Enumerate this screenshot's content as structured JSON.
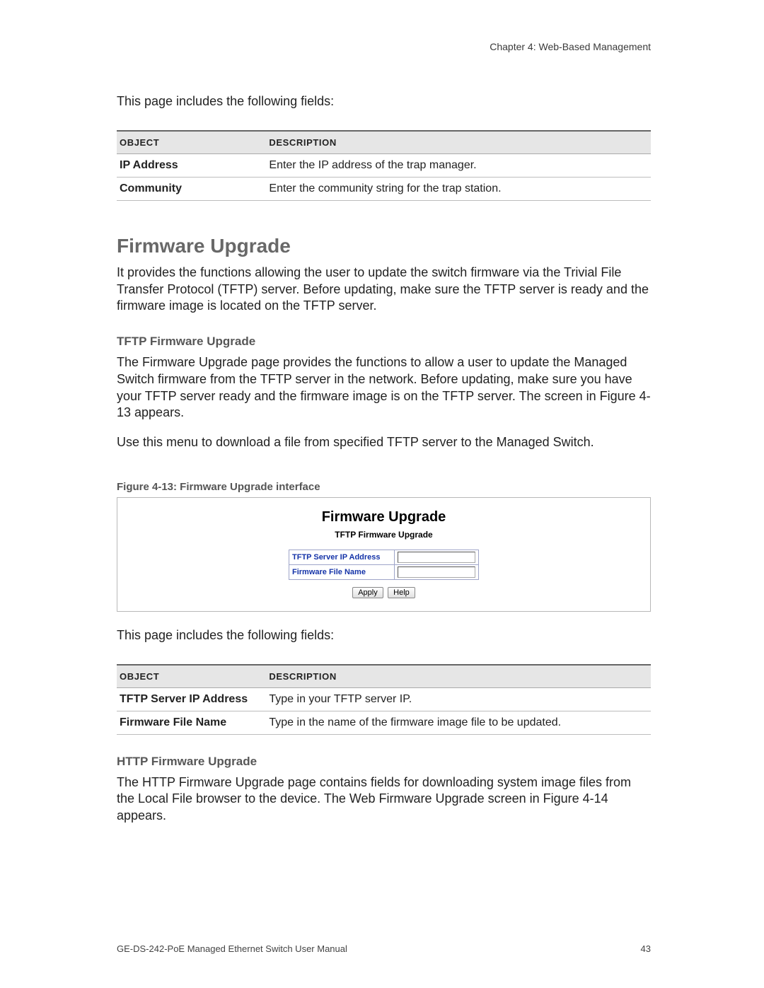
{
  "chapter_header": "Chapter 4: Web-Based Management",
  "intro1": "This page includes the following fields:",
  "table1": {
    "header": {
      "object": "OBJECT",
      "description": "DESCRIPTION"
    },
    "rows": [
      {
        "object": "IP Address",
        "description": "Enter the IP address of the trap manager."
      },
      {
        "object": "Community",
        "description": "Enter the community string for the trap station."
      }
    ]
  },
  "section_title": "Firmware Upgrade",
  "section_intro": "It provides the functions allowing the user to update the switch firmware via the Trivial File Transfer Protocol (TFTP) server. Before updating, make sure the TFTP server is ready and the firmware image is located on the TFTP server.",
  "tftp_heading": "TFTP Firmware Upgrade",
  "tftp_para1": "The Firmware Upgrade page provides the functions to allow a user to update the Managed Switch firmware from the TFTP server in the network. Before updating, make sure you have your TFTP server ready and the firmware image is on the TFTP server. The screen in Figure 4-13 appears.",
  "tftp_para2": "Use this menu to download a file from specified TFTP server to the Managed Switch.",
  "figure_caption": "Figure 4-13:  Firmware Upgrade interface",
  "figure": {
    "title": "Firmware Upgrade",
    "subtitle": "TFTP Firmware Upgrade",
    "rows": [
      {
        "label": "TFTP Server IP Address",
        "value": ""
      },
      {
        "label": "Firmware File Name",
        "value": ""
      }
    ],
    "buttons": {
      "apply": "Apply",
      "help": "Help"
    }
  },
  "intro2": "This page includes the following fields:",
  "table2": {
    "header": {
      "object": "OBJECT",
      "description": "DESCRIPTION"
    },
    "rows": [
      {
        "object": "TFTP Server IP Address",
        "description": "Type in your TFTP server IP."
      },
      {
        "object": "Firmware File Name",
        "description": "Type in the name of the firmware image file to be updated."
      }
    ]
  },
  "http_heading": "HTTP Firmware Upgrade",
  "http_para": "The HTTP Firmware Upgrade page contains fields for downloading system image files from the Local File browser to the device. The Web Firmware Upgrade screen in Figure 4-14 appears.",
  "footer": {
    "left": "GE-DS-242-PoE Managed Ethernet Switch User Manual",
    "right": "43"
  }
}
